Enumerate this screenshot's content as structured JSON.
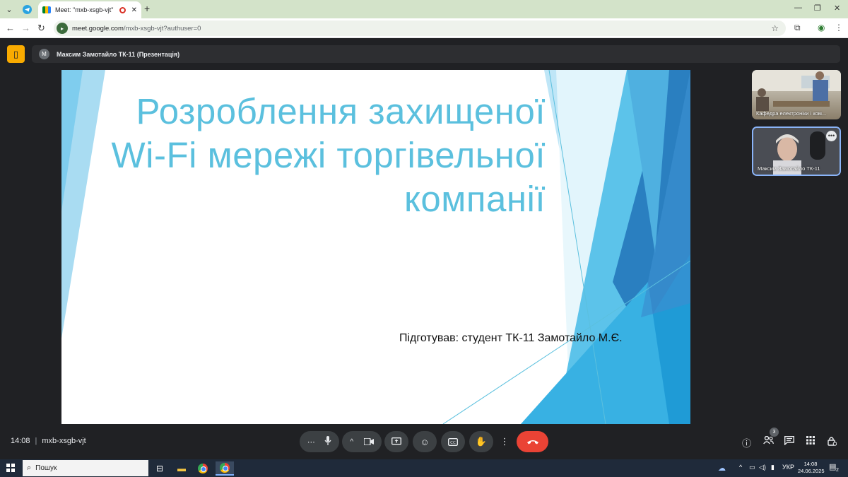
{
  "browser": {
    "tab_title": "Meet: \"mxb-xsgb-vjt\"",
    "url_host": "meet.google.com",
    "url_path": "/mxb-xsgb-vjt?authuser=0"
  },
  "meet": {
    "presenter_initial": "M",
    "presentation_label": "Максим Замотайло ТК-11 (Презентація)",
    "meeting_time": "14:08",
    "meeting_code": "mxb-xsgb-vjt",
    "participant_count": "3"
  },
  "slide": {
    "title_lines": [
      "Розроблення захищеної",
      "Wi-Fi мережі торгівельної",
      "компанії"
    ],
    "subtitle": "Підготував: студент ТК-11 Замотайло М.Є.",
    "accent_color": "#5bc0de"
  },
  "participants": [
    {
      "name": "Кафедра електроніки і ком..."
    },
    {
      "name": "Максим Замотайло ТК-11"
    }
  ],
  "taskbar": {
    "search_placeholder": "Пошук",
    "language": "УКР",
    "time": "14:08",
    "date": "24.06.2025",
    "notification_count": "2"
  }
}
